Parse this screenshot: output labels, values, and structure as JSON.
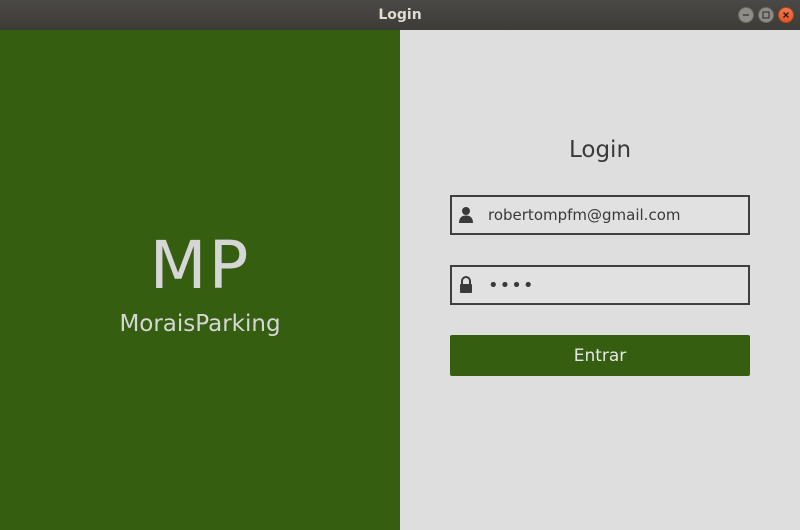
{
  "window": {
    "title": "Login"
  },
  "branding": {
    "mark": "MP",
    "name": "MoraisParking"
  },
  "form": {
    "title": "Login",
    "email": {
      "value": "robertompfm@gmail.com",
      "icon": "user-icon"
    },
    "password": {
      "value": "abcd",
      "icon": "lock-icon"
    },
    "submit_label": "Entrar"
  },
  "colors": {
    "brand_green": "#355e10",
    "panel_background": "#dedede",
    "close_button": "#e2582b"
  }
}
